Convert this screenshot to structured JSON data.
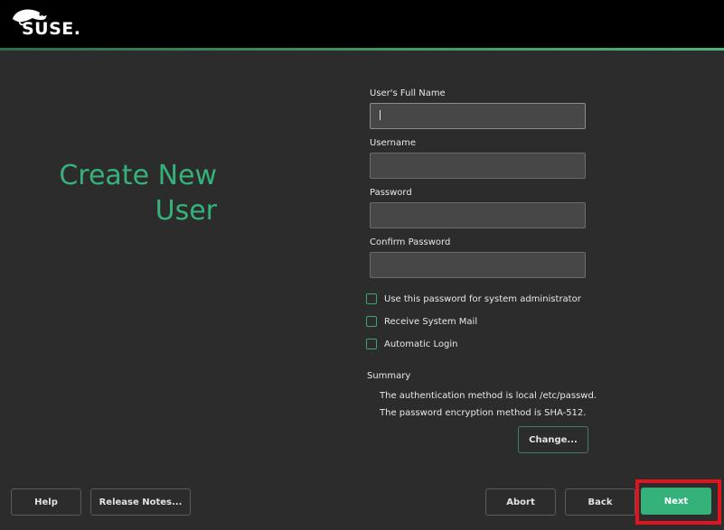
{
  "header": {
    "brand": "SUSE.",
    "logo_icon": "suse-chameleon-logo"
  },
  "page": {
    "title_line1": "Create New",
    "title_line2": "User",
    "accent": "#35b27a"
  },
  "form": {
    "full_name_label": "User's Full Name",
    "full_name_value": "",
    "username_label": "Username",
    "username_value": "",
    "password_label": "Password",
    "password_value": "",
    "confirm_label": "Confirm Password",
    "confirm_value": ""
  },
  "options": {
    "use_password_admin": {
      "label": "Use this password for system administrator",
      "checked": false
    },
    "receive_mail": {
      "label": "Receive System Mail",
      "checked": false
    },
    "auto_login": {
      "label": "Automatic Login",
      "checked": false
    }
  },
  "summary": {
    "title": "Summary",
    "line1": "The authentication method is local /etc/passwd.",
    "line2": "The password encryption method is SHA-512.",
    "change_label": "Change..."
  },
  "footer": {
    "help": "Help",
    "release_notes": "Release Notes...",
    "abort": "Abort",
    "back": "Back",
    "next": "Next"
  }
}
